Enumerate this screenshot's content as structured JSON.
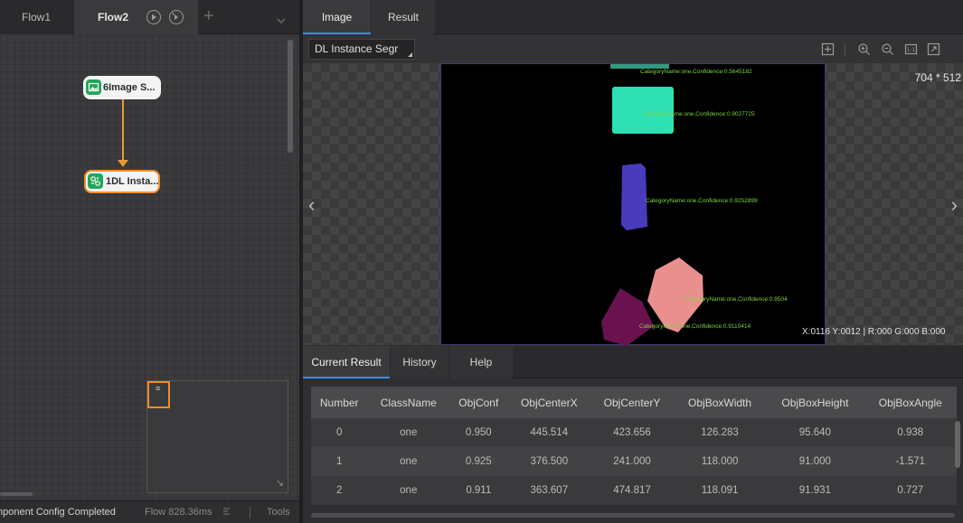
{
  "flow_tabs": {
    "items": [
      {
        "label": "Flow1",
        "active": false
      },
      {
        "label": "Flow2",
        "active": true
      }
    ],
    "add_label": "+",
    "play_icon": "play-circle-icon",
    "step_icon": "step-circle-icon",
    "dropdown_icon": "chevron-down-icon"
  },
  "canvas": {
    "nodes": [
      {
        "label": "6Image S...",
        "icon": "image-source-icon",
        "icon_color": "#23a55a"
      },
      {
        "label": "1DL Insta...",
        "icon": "deep-learning-icon",
        "icon_color": "#23a55a",
        "selected": true
      }
    ],
    "accent_color": "#f08c2a"
  },
  "minimap": {
    "corner_glyph": "↘",
    "viewport_glyph": "≡"
  },
  "status_bar": {
    "message": "mponent Config Completed",
    "flow_time": "Flow  828.36ms",
    "tools_label": "Tools"
  },
  "image_tabs": [
    {
      "label": "Image",
      "active": true
    },
    {
      "label": "Result",
      "active": false
    }
  ],
  "viewer": {
    "module_select_value": "DL Instance Segr",
    "image_size": "704 * 512",
    "pixel_info": "X:0116  Y:0012  |  R:000  G:000  B:000",
    "nav_prev": "‹",
    "nav_next": "›",
    "detections": [
      {
        "label": "CategoryName:one,Confidence:0.5645182",
        "color": "#3fbfa0"
      },
      {
        "label": "CategoryName:one,Confidence:0.9027725",
        "color": "#2ee0b4"
      },
      {
        "label": "CategoryName:one,Confidence:0.9252899",
        "color": "#4a3bbd"
      },
      {
        "label": "CategoryName:one,Confidence:0.9504",
        "color": "#e9908f"
      },
      {
        "label": "CategoryName:one,Confidence:0.9110414",
        "color": "#6a1250"
      }
    ]
  },
  "result_tabs": [
    {
      "label": "Current Result",
      "active": true
    },
    {
      "label": "History",
      "active": false
    },
    {
      "label": "Help",
      "active": false
    }
  ],
  "result_table": {
    "columns": [
      "Number",
      "ClassName",
      "ObjConf",
      "ObjCenterX",
      "ObjCenterY",
      "ObjBoxWidth",
      "ObjBoxHeight",
      "ObjBoxAngle"
    ],
    "rows": [
      [
        "0",
        "one",
        "0.950",
        "445.514",
        "423.656",
        "126.283",
        "95.640",
        "0.938"
      ],
      [
        "1",
        "one",
        "0.925",
        "376.500",
        "241.000",
        "118.000",
        "91.000",
        "-1.571"
      ],
      [
        "2",
        "one",
        "0.911",
        "363.607",
        "474.817",
        "118.091",
        "91.931",
        "0.727"
      ]
    ]
  },
  "colors": {
    "accent_blue": "#3d8ee6",
    "node_highlight": "#f08c2a",
    "label_green": "#7fd443"
  }
}
